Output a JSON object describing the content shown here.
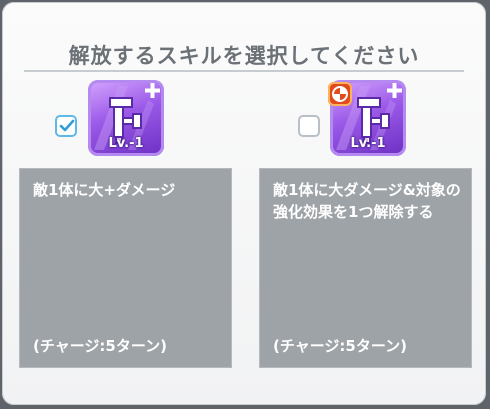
{
  "dialog": {
    "title": "解放するスキルを選択してください"
  },
  "options": [
    {
      "checked": true,
      "level_label": "Lv.-1",
      "description": "敵1体に大+ダメージ",
      "charge": "(チャージ:5ターン)",
      "icon": "skill-sword-icon",
      "badge": null
    },
    {
      "checked": false,
      "level_label": "Lv.-1",
      "description": "敵1体に大ダメージ&対象の強化効果を1つ解除する",
      "charge": "(チャージ:5ターン)",
      "icon": "skill-sword-icon",
      "badge": "fire-element-icon"
    }
  ],
  "colors": {
    "checkbox_accent": "#5fb9e6",
    "skill_purple": "#9b5ae8",
    "description_bg": "#9ea3a7"
  }
}
